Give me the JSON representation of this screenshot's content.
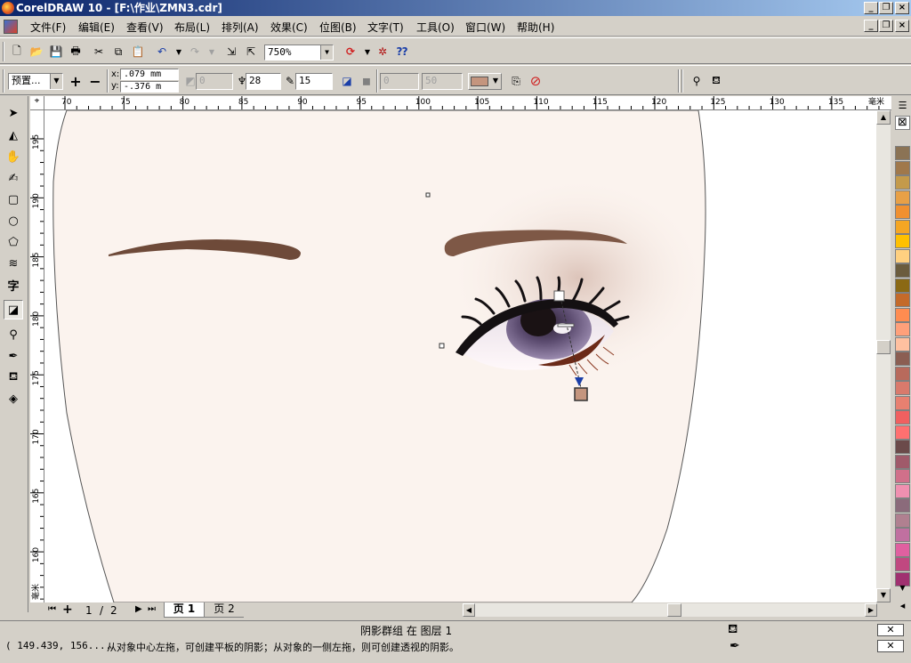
{
  "window": {
    "title": "CorelDRAW 10 - [F:\\作业\\ZMN3.cdr]"
  },
  "menu": [
    "文件(F)",
    "编辑(E)",
    "查看(V)",
    "布局(L)",
    "排列(A)",
    "效果(C)",
    "位图(B)",
    "文字(T)",
    "工具(O)",
    "窗口(W)",
    "帮助(H)"
  ],
  "toolbar": {
    "zoom": "750%"
  },
  "property_bar": {
    "preset": "预置...",
    "x_label": "x:",
    "y_label": "y:",
    "x": ".079 mm",
    "y": "-.376 m",
    "offset_disabled": "0",
    "opacity": "28",
    "feather": "15",
    "fade_disabled": "0",
    "stretch_disabled": "50",
    "shadow_color": "#c4957e"
  },
  "rulers": {
    "h_ticks": [
      "70",
      "75",
      "80",
      "85",
      "90",
      "95",
      "100",
      "105",
      "110",
      "115",
      "120",
      "125",
      "130",
      "135"
    ],
    "v_ticks": [
      "195",
      "190",
      "185",
      "180",
      "175",
      "170",
      "165",
      "160",
      "15"
    ],
    "unit": "毫米",
    "v_unit": "毫米"
  },
  "pages": {
    "current": "1",
    "total": "2",
    "separator": "/",
    "tab1": "页 1",
    "tab2": "页 2"
  },
  "status": {
    "object_info": "阴影群组 在 图层 1",
    "coordinates": "( 149.439, 156.... ",
    "hint": "从对象中心左拖，可创建平板的阴影；从对象的一侧左拖，则可创建透视的阴影。"
  },
  "palette": [
    "#8b7355",
    "#a0784b",
    "#c49a4a",
    "#e8a046",
    "#f09030",
    "#f5a623",
    "#ffc000",
    "#ffd080",
    "#6b5c3e",
    "#8b6914",
    "#c46a2a",
    "#ff8c50",
    "#ffa07a",
    "#ffc0a0",
    "#8b5e52",
    "#b86a5c",
    "#d97a6c",
    "#e88070",
    "#f06060",
    "#ff7070",
    "#6b4a4a",
    "#a05a6a",
    "#d0708a",
    "#f090b0",
    "#8b6b7b",
    "#b08090",
    "#c070a0",
    "#e060a0",
    "#c04880",
    "#a03070"
  ]
}
